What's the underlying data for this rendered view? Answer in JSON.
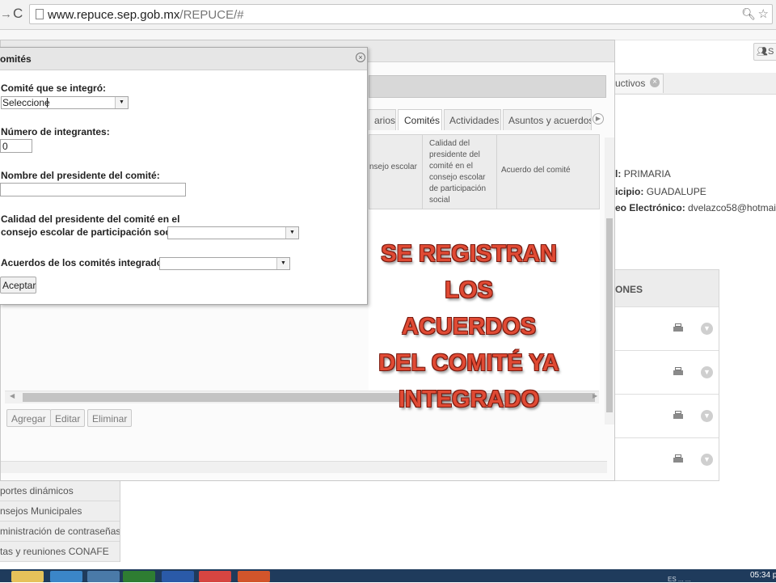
{
  "browser": {
    "url_host": "www.repuce.sep.gob.mx",
    "url_path": "/REPUCE/#",
    "nav_forward_glyph": "→",
    "nav_reload_glyph": "C",
    "icons": [
      "page-icon",
      "zoom-icon",
      "bookmark-star-icon"
    ]
  },
  "background": {
    "user_button_label": "S",
    "tab_productivos": "uctivos",
    "school_info": {
      "level_label": "l:",
      "level_value": "PRIMARIA",
      "municipio_label": "icipio:",
      "municipio_value": "GUADALUPE",
      "email_label": "eo Electrónico:",
      "email_value": "dvelazco58@hotmail.com"
    },
    "panel_header": "ONES",
    "panel_rows": 4
  },
  "mid_dialog": {
    "tabs": [
      "arios",
      "Comités",
      "Actividades",
      "Asuntos y acuerdos"
    ],
    "selected_tab": "Comités",
    "grid_headers": [
      "nsejo escolar",
      "Calidad del presidente del comité en el consejo escolar de participación social",
      "Acuerdo del comité"
    ],
    "buttons": {
      "add": "Agregar",
      "edit": "Editar",
      "delete": "Eliminar"
    }
  },
  "left_nav": [
    "portes dinámicos",
    "nsejos Municipales",
    "ministración de contraseñas",
    "tas y reuniones CONAFE"
  ],
  "front_dialog": {
    "title": "omités",
    "comite_label": "Comité que se integró:",
    "comite_value": "Seleccione",
    "integrantes_label": "Número de integrantes:",
    "integrantes_value": "0",
    "presidente_label": "Nombre del presidente del comité:",
    "presidente_value": "",
    "calidad_label_line1": "Calidad del presidente del comité en el",
    "calidad_label_line2": "consejo escolar de participación social:",
    "calidad_value": "",
    "acuerdos_label": "Acuerdos de los comités integrados:",
    "acuerdos_value": "",
    "accept_label": "Aceptar"
  },
  "overlay_text": [
    "SE REGISTRAN",
    "LOS",
    "ACUERDOS",
    "DEL COMITÉ YA",
    "INTEGRADO"
  ],
  "taskbar": {
    "clock": "05:34 p",
    "tray_text": "ES  ...  ...",
    "apps": [
      "folder",
      "ie",
      "explorer",
      "excel",
      "word",
      "chrome",
      "powerpoint"
    ]
  },
  "colors": {
    "overlay_text": "#e04a34",
    "taskbar": "#1f3b5c"
  }
}
